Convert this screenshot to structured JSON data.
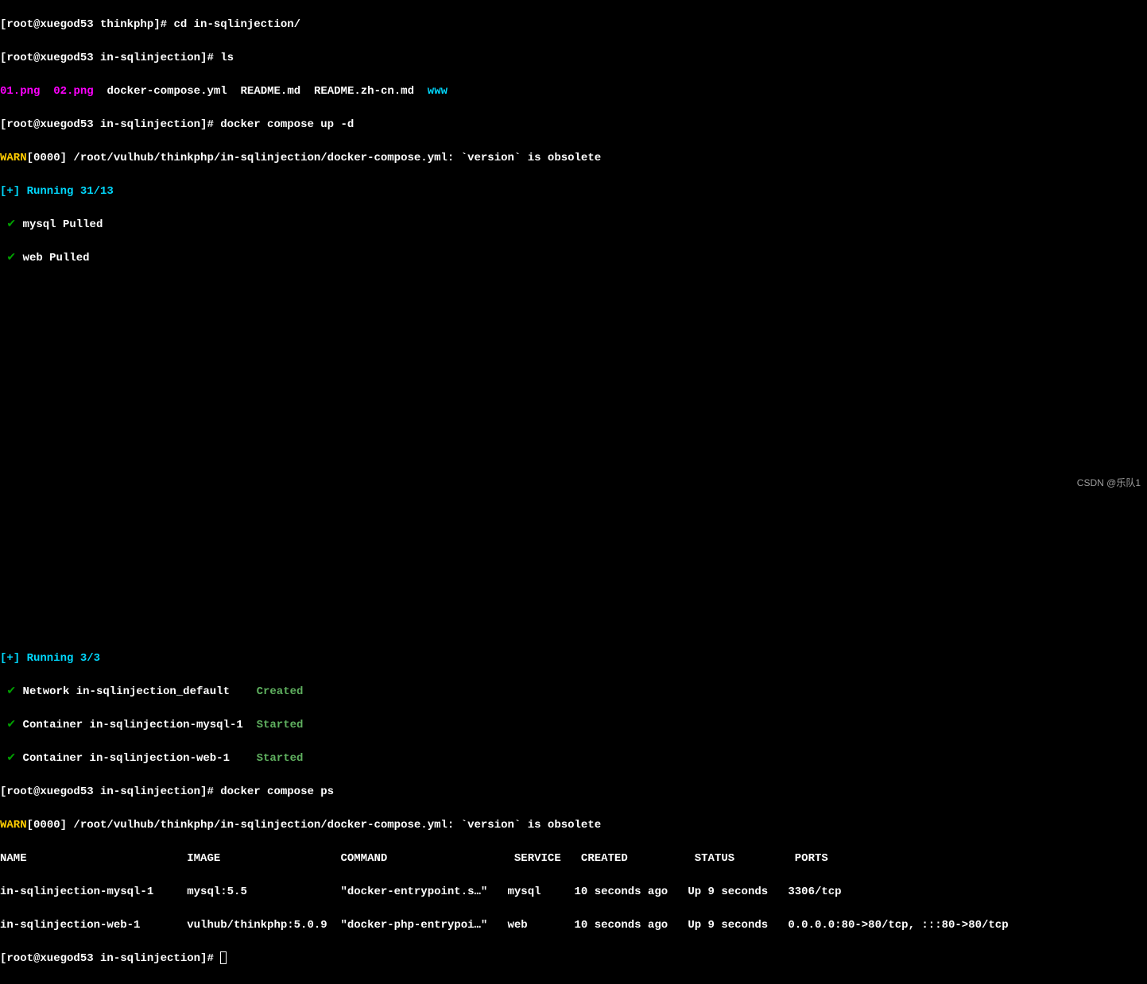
{
  "lines": {
    "l1_prompt": "[root@xuegod53 thinkphp]# ",
    "l1_cmd": "cd in-sqlinjection/",
    "l2_prompt": "[root@xuegod53 in-sqlinjection]# ",
    "l2_cmd": "ls",
    "l3_file1": "01.png",
    "l3_file2": "02.png",
    "l3_file3": "docker-compose.yml",
    "l3_file4": "README.md",
    "l3_file5": "README.zh-cn.md",
    "l3_file6": "www",
    "l4_prompt": "[root@xuegod53 in-sqlinjection]# ",
    "l4_cmd": "docker compose up -d",
    "l5_warn": "WARN",
    "l5_text": "[0000] /root/vulhub/thinkphp/in-sqlinjection/docker-compose.yml: `version` is obsolete ",
    "l6_running": "[+] Running 31/13",
    "l7_check": " ✔",
    "l7_text": " mysql Pulled ",
    "l8_check": " ✔",
    "l8_text": " web Pulled ",
    "l9_running": "[+] Running 3/3",
    "l10_check": " ✔",
    "l10_text": " Network in-sqlinjection_default    ",
    "l10_status": "Created",
    "l11_check": " ✔",
    "l11_text": " Container in-sqlinjection-mysql-1  ",
    "l11_status": "Started",
    "l12_check": " ✔",
    "l12_text": " Container in-sqlinjection-web-1    ",
    "l12_status": "Started",
    "l13_prompt": "[root@xuegod53 in-sqlinjection]# ",
    "l13_cmd": "docker compose ps",
    "l14_warn": "WARN",
    "l14_text": "[0000] /root/vulhub/thinkphp/in-sqlinjection/docker-compose.yml: `version` is obsolete ",
    "header": "NAME                        IMAGE                  COMMAND                   SERVICE   CREATED          STATUS         PORTS",
    "row1": "in-sqlinjection-mysql-1     mysql:5.5              \"docker-entrypoint.s…\"   mysql     10 seconds ago   Up 9 seconds   3306/tcp",
    "row2": "in-sqlinjection-web-1       vulhub/thinkphp:5.0.9  \"docker-php-entrypoi…\"   web       10 seconds ago   Up 9 seconds   0.0.0.0:80->80/tcp, :::80->80/tcp",
    "l18_prompt": "[root@xuegod53 in-sqlinjection]# "
  },
  "watermark": "CSDN @乐队1",
  "ps_table": {
    "columns": [
      "NAME",
      "IMAGE",
      "COMMAND",
      "SERVICE",
      "CREATED",
      "STATUS",
      "PORTS"
    ],
    "rows": [
      {
        "name": "in-sqlinjection-mysql-1",
        "image": "mysql:5.5",
        "command": "\"docker-entrypoint.s…\"",
        "service": "mysql",
        "created": "10 seconds ago",
        "status": "Up 9 seconds",
        "ports": "3306/tcp"
      },
      {
        "name": "in-sqlinjection-web-1",
        "image": "vulhub/thinkphp:5.0.9",
        "command": "\"docker-php-entrypoi…\"",
        "service": "web",
        "created": "10 seconds ago",
        "status": "Up 9 seconds",
        "ports": "0.0.0.0:80->80/tcp, :::80->80/tcp"
      }
    ]
  }
}
